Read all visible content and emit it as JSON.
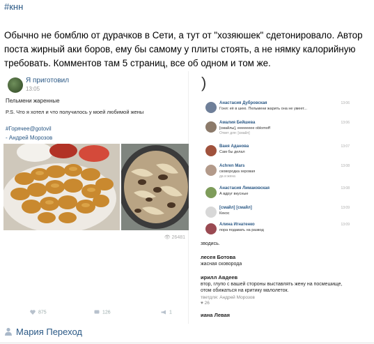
{
  "hashtag": "#кнн",
  "post_text": "Обычно не бомблю от дурачков в Сети, а тут от \"хозяюшек\" сдетонировало. Автор поста жирный аки боров, ему бы самому у плиты стоять, а не нямку калорийную требовать. Комментов там 5 страниц, все об одном и том же.",
  "screenshot_post": {
    "author": "Я приготовил",
    "time": "13:05",
    "line1": "Пельмени жаренные",
    "line2": "P.S. Что я хотел и что получилось у моей любимой жены",
    "tag": "#Горячее@gotovil",
    "signature": "- Андрей Морозов",
    "views": "26481",
    "likes": "875",
    "comments": "126",
    "reposts": "1"
  },
  "comments_panel": {
    "bracket": ")",
    "items": [
      {
        "name": "Анастасия Дубровская",
        "text": "Гоня: её в шею. Пельмени жарить она не умеет...",
        "reply": "",
        "date": "13:06"
      },
      {
        "name": "Амалия Бейшева",
        "text": "[смайлы], ееееееее oblomoff",
        "reply": "Ответ для: [смайл]",
        "date": "13:06"
      },
      {
        "name": "Ваня Аданова",
        "text": "Сам бы делал",
        "reply": "",
        "date": "13:07"
      },
      {
        "name": "Achren Mars",
        "text": "сковородка херовая",
        "reply": "да и жена",
        "date": "13:08"
      },
      {
        "name": "Анастасия Лимаковская",
        "text": "А вдруг вкусные",
        "reply": "",
        "date": "13:08"
      },
      {
        "name": "[смайл] [смайл]",
        "text": "Кекос",
        "reply": "",
        "date": "13:09"
      },
      {
        "name": "Алина Игнатенко",
        "text": "пора подавать на развод",
        "reply": "",
        "date": "13:09"
      }
    ],
    "lower": {
      "cut_text": "зводись.",
      "c1_name": "лесея Ботова",
      "c1_text": "жасная сковорода",
      "c2_name": "ирилл Авдеев",
      "c2_text": "втор, глупо с вашей стороны выставлять жену на посмешище,",
      "c2_text2": "отом обижаться на критику малолеток.",
      "c2_reply": "тветдля: Андрей Морозов",
      "c2_likes": "26",
      "c3_name": "иана Левая"
    }
  },
  "footer_author": "Мария Переход",
  "colors": {
    "link": "#2a5885"
  }
}
